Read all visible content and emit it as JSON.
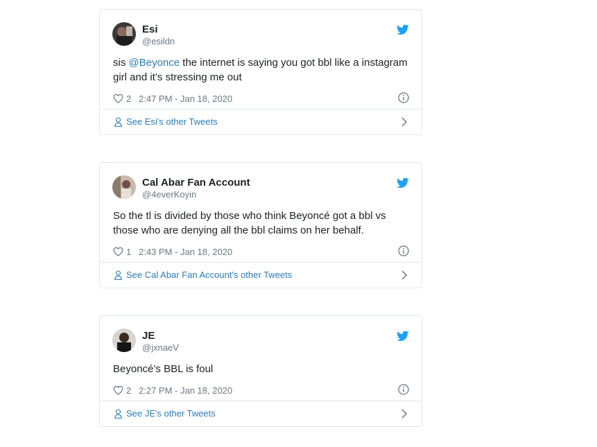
{
  "tweets": [
    {
      "name": "Esi",
      "handle": "@esildn",
      "text_before": "sis ",
      "mention": "@Beyonce",
      "text_after": " the internet is saying you got bbl like a instagram girl and it’s stressing me out",
      "likes": "2",
      "time": "2:47 PM - Jan 18, 2020",
      "see_label": "See Esi's other Tweets",
      "icons": {
        "like": "heart-icon",
        "info": "info-icon",
        "brand": "twitter-bird-icon",
        "profile": "person-icon",
        "more": "chevron-right-icon"
      }
    },
    {
      "name": "Cal Abar Fan Account",
      "handle": "@4everKoyin",
      "text": "So the tl is divided by those who think Beyoncé got a bbl vs those who are denying all the bbl claims on her behalf.",
      "likes": "1",
      "time": "2:43 PM - Jan 18, 2020",
      "see_label": "See Cal Abar Fan Account's other Tweets"
    },
    {
      "name": "JE",
      "handle": "@jxnaeV",
      "text": "Beyoncé’s BBL is foul",
      "likes": "2",
      "time": "2:27 PM - Jan 18, 2020",
      "see_label": "See JE's other Tweets"
    }
  ],
  "colors": {
    "accent": "#2b7bb9",
    "brand": "#1da1f2",
    "muted": "#697882",
    "border": "#e1e8ed"
  }
}
